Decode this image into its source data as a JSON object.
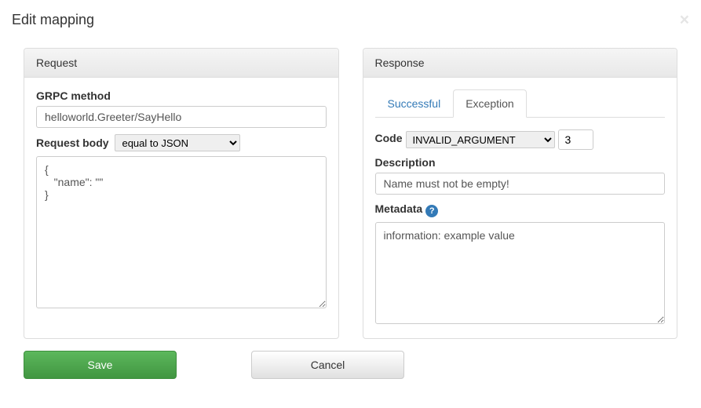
{
  "header": {
    "title": "Edit mapping",
    "close_glyph": "×"
  },
  "request": {
    "panel_title": "Request",
    "grpc_method_label": "GRPC method",
    "grpc_method_value": "helloworld.Greeter/SayHello",
    "body_label": "Request body",
    "body_matcher_selected": "equal to JSON",
    "body_value": "{\n   \"name\": \"\"\n}"
  },
  "response": {
    "panel_title": "Response",
    "tabs": {
      "successful": "Successful",
      "exception": "Exception"
    },
    "active_tab": "exception",
    "code_label": "Code",
    "code_selected": "INVALID_ARGUMENT",
    "code_number": "3",
    "description_label": "Description",
    "description_value": "Name must not be empty!",
    "metadata_label": "Metadata",
    "help_glyph": "?",
    "metadata_value": "information: example value"
  },
  "footer": {
    "save_label": "Save",
    "cancel_label": "Cancel"
  }
}
